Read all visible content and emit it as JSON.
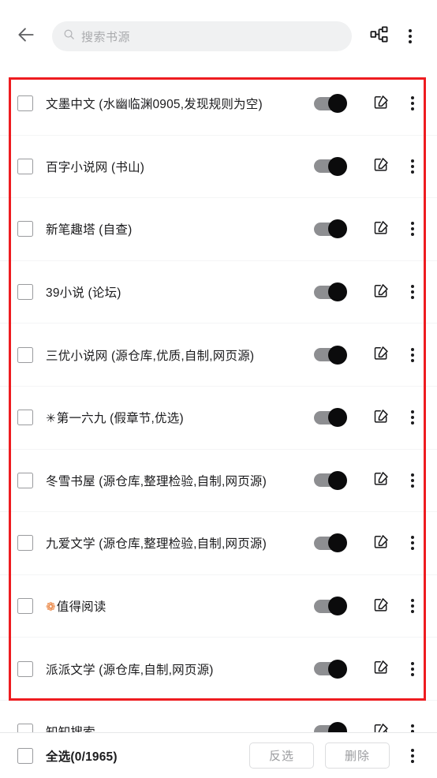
{
  "topbar": {
    "back_icon": "arrow-left-icon",
    "search": {
      "placeholder": "搜索书源",
      "value": "",
      "icon": "search-icon"
    },
    "group_icon": "hierarchy-group-icon",
    "overflow_icon": "more-vertical-icon"
  },
  "list": {
    "row_toggle_icon": "toggle-switch-on",
    "row_edit_icon": "edit-pencil-icon",
    "row_menu_icon": "more-vertical-icon",
    "rows": [
      {
        "prefix": "",
        "prefix_type": "",
        "label": "文墨中文 (水幽临渊0905,发现规则为空)",
        "enabled": true,
        "checked": false
      },
      {
        "prefix": "",
        "prefix_type": "",
        "label": "百字小说网 (书山)",
        "enabled": true,
        "checked": false
      },
      {
        "prefix": "",
        "prefix_type": "",
        "label": "新笔趣塔 (自查)",
        "enabled": true,
        "checked": false
      },
      {
        "prefix": "",
        "prefix_type": "",
        "label": "39小说 (论坛)",
        "enabled": true,
        "checked": false
      },
      {
        "prefix": "",
        "prefix_type": "",
        "label": "三优小说网 (源仓库,优质,自制,网页源)",
        "enabled": true,
        "checked": false
      },
      {
        "prefix": "✳",
        "prefix_type": "star",
        "label": "第一六九 (假章节,优选)",
        "enabled": true,
        "checked": false
      },
      {
        "prefix": "",
        "prefix_type": "",
        "label": "冬雪书屋 (源仓库,整理检验,自制,网页源)",
        "enabled": true,
        "checked": false
      },
      {
        "prefix": "",
        "prefix_type": "",
        "label": "九爱文学 (源仓库,整理检验,自制,网页源)",
        "enabled": true,
        "checked": false
      },
      {
        "prefix": "❁",
        "prefix_type": "flower",
        "label": "值得阅读",
        "enabled": true,
        "checked": false
      },
      {
        "prefix": "",
        "prefix_type": "",
        "label": "派派文学 (源仓库,自制,网页源)",
        "enabled": true,
        "checked": false
      },
      {
        "prefix": "",
        "prefix_type": "",
        "label": "知知搜索",
        "enabled": true,
        "checked": false
      }
    ]
  },
  "annotation": {
    "color": "#ee1c20"
  },
  "bottombar": {
    "select_all_label": "全选(0/1965)",
    "select_all_checked": false,
    "invert_label": "反选",
    "delete_label": "删除",
    "overflow_icon": "more-vertical-icon"
  }
}
